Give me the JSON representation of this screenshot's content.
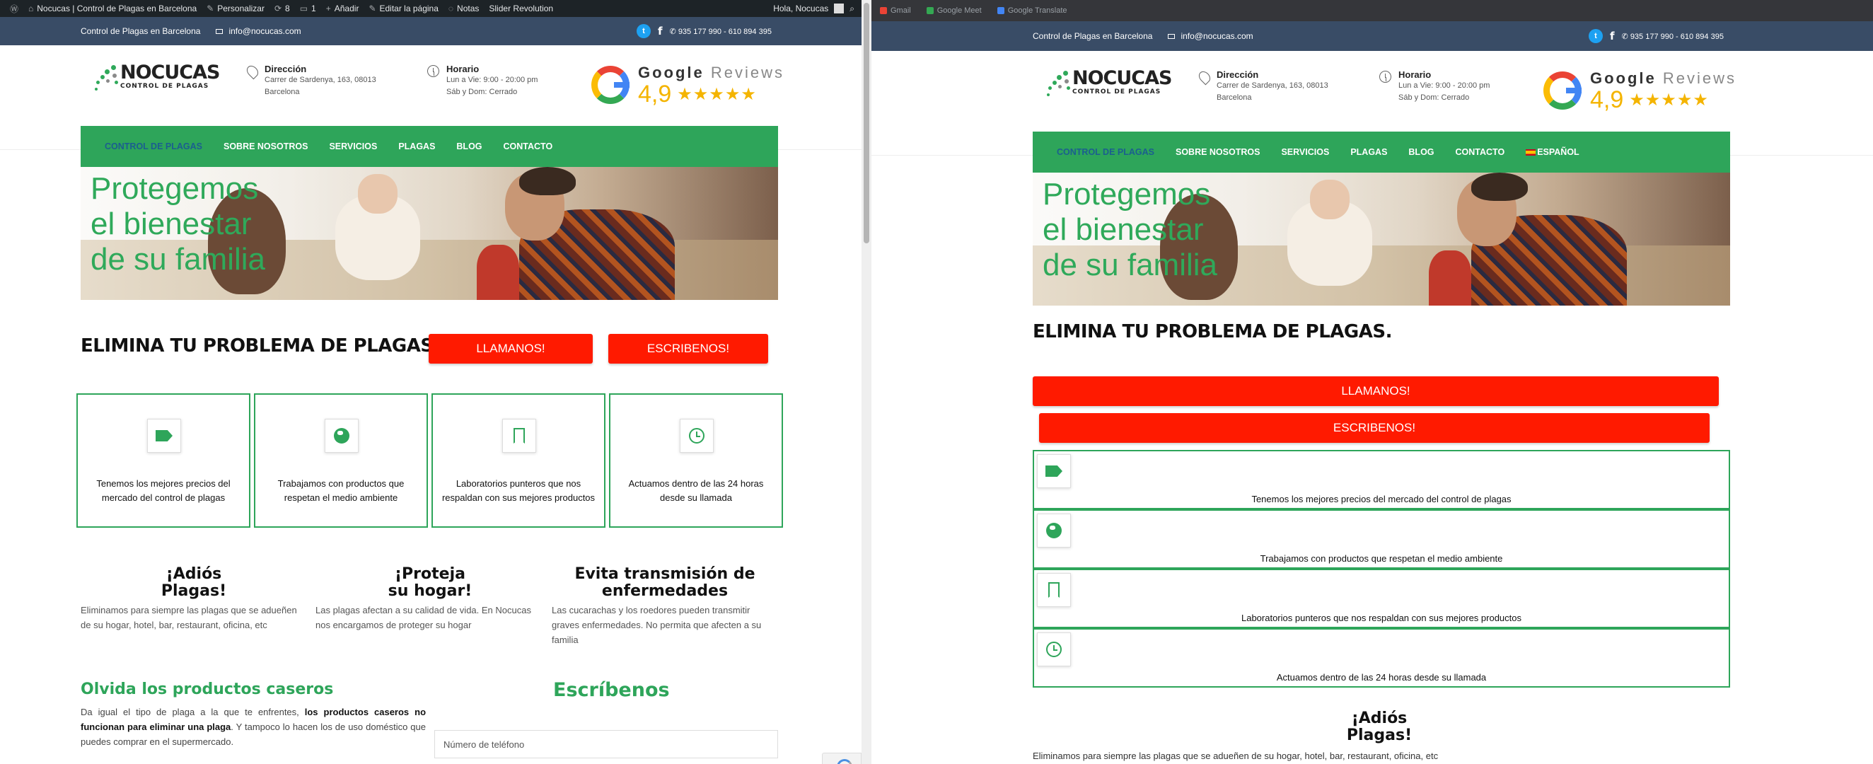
{
  "admin_bar": {
    "site_name": "Nocucas | Control de Plagas en Barcelona",
    "customize": "Personalizar",
    "updates": "8",
    "comments": "1",
    "add_new": "Añadir",
    "edit_page": "Editar la página",
    "notes": "Notas",
    "slider": "Slider Revolution",
    "greeting": "Hola, Nocucas"
  },
  "bookmarks": [
    {
      "label": "Gmail",
      "color": "#ea4335"
    },
    {
      "label": "Google Meet",
      "color": "#34a853"
    },
    {
      "label": "Google Translate",
      "color": "#4285f4"
    }
  ],
  "top_strip": {
    "tagline": "Control de Plagas en Barcelona",
    "email": "info@nocucas.com",
    "phone": "935 177 990 - 610 894 395"
  },
  "header": {
    "logo_name": "NOCUCAS",
    "logo_sub": "CONTROL DE PLAGAS",
    "address_title": "Dirección",
    "address_line1": "Carrer de Sardenya, 163, 08013",
    "address_line2": "Barcelona",
    "hours_title": "Horario",
    "hours_line1": "Lun a Vie: 9:00 - 20:00 pm",
    "hours_line2": "Sáb y Dom: Cerrado",
    "google_word": "Google",
    "reviews_word": "Reviews",
    "rating": "4,9",
    "stars": "★★★★★"
  },
  "nav": {
    "items": [
      "CONTROL DE PLAGAS",
      "SOBRE NOSOTROS",
      "SERVICIOS",
      "PLAGAS",
      "BLOG",
      "CONTACTO"
    ],
    "language": "ESPAÑOL"
  },
  "hero": {
    "line1": "Protegemos",
    "line2": "el bienestar",
    "line3": "de su familia"
  },
  "cta": {
    "heading": "ELIMINA TU PROBLEMA DE PLAGAS.",
    "call_label": "LLAMANOS!",
    "write_label": "ESCRIBENOS!"
  },
  "features": [
    {
      "icon": "price-tag-icon",
      "text": "Tenemos los mejores precios del mercado del control de plagas"
    },
    {
      "icon": "globe-icon",
      "text": "Trabajamos con productos que respetan el medio ambiente"
    },
    {
      "icon": "bookmark-icon",
      "text": "Laboratorios punteros que nos respaldan con sus mejores productos"
    },
    {
      "icon": "clock-icon",
      "text": "Actuamos dentro de las 24 horas desde su llamada"
    }
  ],
  "benefits": [
    {
      "title1": "¡Adiós",
      "title2": "Plagas!",
      "text": "Eliminamos para siempre las plagas que se adueñen de su hogar, hotel, bar, restaurant, oficina, etc"
    },
    {
      "title1": "¡Proteja",
      "title2": "su hogar!",
      "text": "Las plagas afectan a su calidad de vida. En Nocucas nos encargamos de proteger su hogar"
    },
    {
      "title1": "Evita transmisión de",
      "title2": "enfermedades",
      "text": "Las cucarachas y los roedores pueden transmitir graves enfermedades. No permita que afecten a su familia"
    }
  ],
  "homemade": {
    "title": "Olvida los productos caseros",
    "text_a": "Da igual el tipo de plaga a la que te enfrentes, ",
    "text_b": "los productos caseros no funcionan para eliminar una plaga",
    "text_c": ". Y tampoco lo hacen los de uso doméstico que puedes comprar en el supermercado."
  },
  "contact_form": {
    "title": "Escríbenos",
    "phone_placeholder": "Número de teléfono"
  }
}
